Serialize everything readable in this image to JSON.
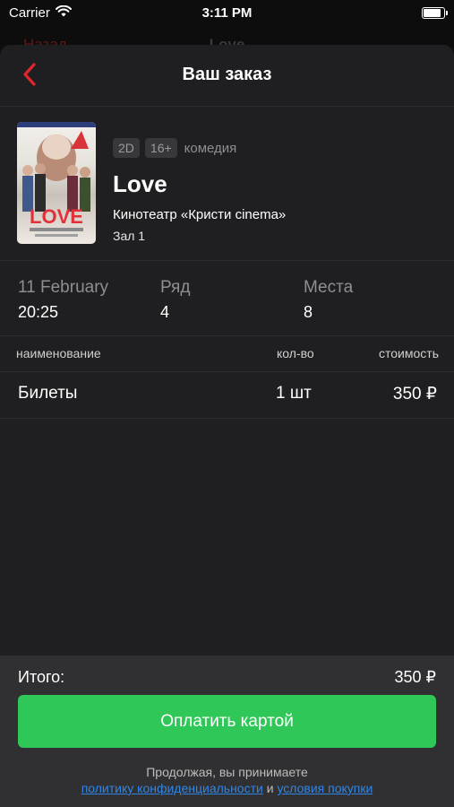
{
  "status_bar": {
    "carrier": "Carrier",
    "time": "3:11 PM",
    "battery_level": 0.95
  },
  "background_nav": {
    "left": "Назад",
    "center": "Love"
  },
  "header": {
    "title": "Ваш заказ"
  },
  "film": {
    "format": "2D",
    "age": "16+",
    "genre": "комедия",
    "title": "Love",
    "cinema": "Кинотеатр «Кристи cinema»",
    "hall": "Зал 1",
    "poster_word": "LOVE"
  },
  "session": {
    "date": "11 February",
    "time": "20:25",
    "row_label": "Ряд",
    "row": "4",
    "seats_label": "Места",
    "seats": "8"
  },
  "order_table": {
    "headers": [
      "наименование",
      "кол-во",
      "стоимость"
    ],
    "rows": [
      {
        "name": "Билеты",
        "qty": "1 шт",
        "price": "350 ₽"
      }
    ]
  },
  "footer": {
    "total_label": "Итого:",
    "total_value": "350 ₽",
    "pay_button": "Оплатить картой",
    "agree_text": "Продолжая, вы принимаете",
    "privacy_link": "политику конфиденциальности",
    "and": "и",
    "terms_link": "условия покупки"
  },
  "colors": {
    "accent_back": "#e0262b",
    "pay_green": "#30c759",
    "link_blue": "#2f86e6",
    "sheet_bg": "#1f1f21",
    "footer_bg": "#303032"
  }
}
